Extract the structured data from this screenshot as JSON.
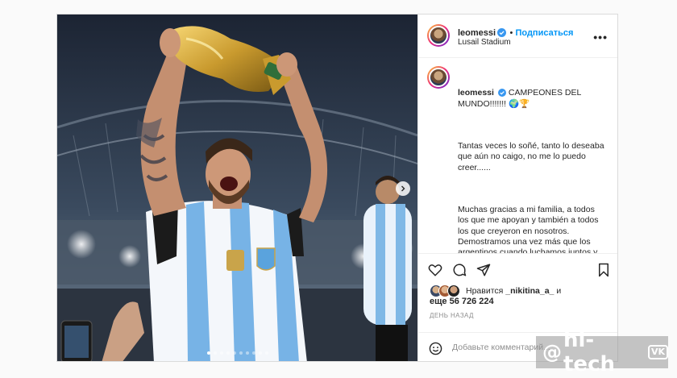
{
  "post": {
    "username": "leomessi",
    "follow_label": "Подписаться",
    "location": "Lusail Stadium",
    "more_label": "•••",
    "caption_head": "CAMPEONES DEL MUNDO!!!!!!! 🌍🏆",
    "caption_p1": "Tantas veces lo soñé, tanto lo deseaba que aún no caigo, no me lo puedo creer......",
    "caption_p2": "Muchas gracias a mi familia, a todos los que me apoyan y también a todos los que creyeron en nosotros. Demostramos una vez más que los argentinos cuando luchamos juntos y unidos somos capaces de conseguir lo que nos propongamos. El mérito es de este grupo, que está por encima de las individualidades, es la fuerza de todos peleando por un mismo sueño",
    "liked_by_prefix": "Нравится",
    "liked_by_user": "_nikitina_a_",
    "liked_by_suffix": "и",
    "likes_count": "еще 56 726 224",
    "time_ago": "ДЕНЬ НАЗАД",
    "comment_placeholder": "Добавьте комментарий...",
    "carousel_total": 10,
    "carousel_active": 0
  },
  "watermark": {
    "at": "@",
    "text": "hi-tech",
    "vk": "VK"
  },
  "colors": {
    "link": "#0095f6",
    "verified": "#3897f0",
    "muted": "#8e8e8e"
  },
  "icons": [
    "verified-badge-icon",
    "more-options-icon",
    "heart-icon",
    "comment-icon",
    "share-icon",
    "bookmark-icon",
    "emoji-icon",
    "chevron-right-icon"
  ]
}
